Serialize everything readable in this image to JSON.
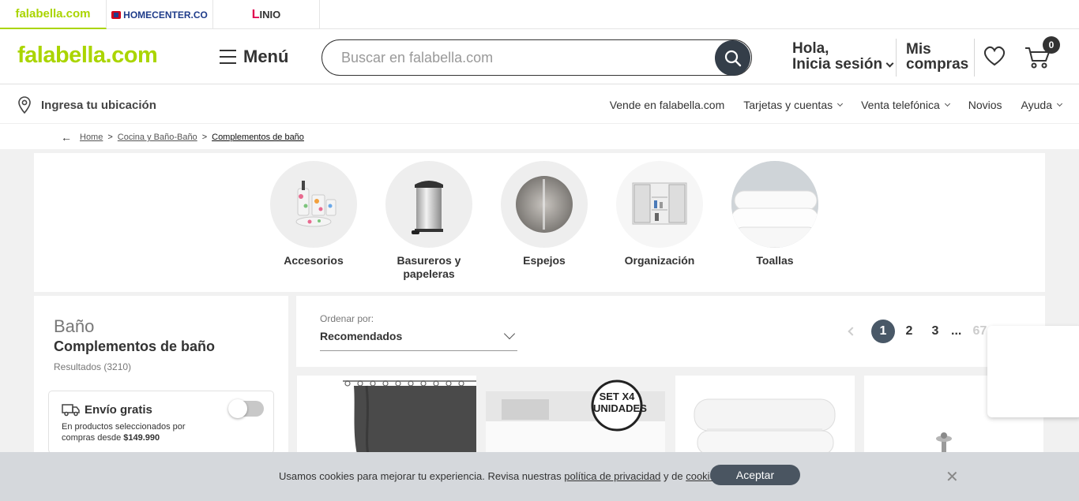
{
  "stores": [
    {
      "label": "falabella.com"
    },
    {
      "label": "HOMECENTER.CO"
    },
    {
      "label": "INIO",
      "prefix": "L"
    }
  ],
  "header": {
    "logo": "falabella.com",
    "menu_label": "Menú",
    "search_placeholder": "Buscar en falabella.com",
    "login_line1": "Hola,",
    "login_line2": "Inicia sesión",
    "purchases_line1": "Mis",
    "purchases_line2": "compras",
    "cart_count": "0"
  },
  "location_bar": {
    "location_label": "Ingresa tu ubicación",
    "links": [
      {
        "label": "Vende en falabella.com",
        "dropdown": false
      },
      {
        "label": "Tarjetas y cuentas",
        "dropdown": true
      },
      {
        "label": "Venta telefónica",
        "dropdown": true
      },
      {
        "label": "Novios",
        "dropdown": false
      },
      {
        "label": "Ayuda",
        "dropdown": true
      }
    ]
  },
  "breadcrumb": {
    "items": [
      "Home",
      "Cocina y Baño-Baño"
    ],
    "current": "Complementos de baño",
    "separator": ">"
  },
  "categories": [
    {
      "label": "Accesorios"
    },
    {
      "label": "Basureros y papeleras"
    },
    {
      "label": "Espejos"
    },
    {
      "label": "Organización"
    },
    {
      "label": "Toallas"
    }
  ],
  "filters": {
    "category": "Baño",
    "title": "Complementos de baño",
    "results": "Resultados (3210)",
    "free_shipping": {
      "title": "Envío gratis",
      "desc_line1": "En productos seleccionados por",
      "desc_line2_prefix": "compras desde ",
      "desc_amount": "$149.990",
      "enabled": false
    }
  },
  "sort": {
    "label": "Ordenar por:",
    "value": "Recomendados"
  },
  "pagination": {
    "pages": [
      "1",
      "2",
      "3"
    ],
    "ellipsis": "...",
    "last": "67",
    "current": "1"
  },
  "products": [
    {
      "badge": ""
    },
    {
      "badge": "SET X4 UNIDADES"
    },
    {
      "badge": ""
    },
    {
      "badge": ""
    }
  ],
  "cookie": {
    "text_1": "Usamos cookies para mejorar tu experiencia. Revisa nuestras ",
    "link_privacy": "política de privacidad",
    "text_2": " y de ",
    "link_cookies": "cookies",
    "text_3": ".",
    "accept": "Aceptar"
  },
  "colors": {
    "brand_green": "#aad500",
    "dark_slate": "#343e49",
    "pager_active": "#495867"
  }
}
